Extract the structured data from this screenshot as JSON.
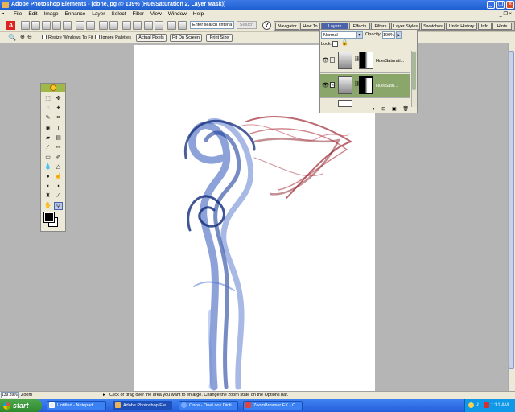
{
  "window": {
    "title": "Adobe Photoshop Elements - [done.jpg @ 139% (Hue/Saturation 2, Layer Mask)]",
    "controls": [
      "_",
      "❐",
      "×"
    ]
  },
  "menu": [
    "File",
    "Edit",
    "Image",
    "Enhance",
    "Layer",
    "Select",
    "Filter",
    "View",
    "Window",
    "Help"
  ],
  "shortcuts": {
    "search_placeholder": "Enter search criteria",
    "search_button": "Search",
    "help_icon": "?"
  },
  "palette_tabs": [
    "Navigator",
    "How To",
    "Layers",
    "Effects",
    "Filters",
    "Layer Styles",
    "Swatches",
    "Undo History",
    "Info",
    "Hints"
  ],
  "options": {
    "resize_windows": "Resize Windows To Fit",
    "ignore_palettes": "Ignore Palettes",
    "actual_pixels": "Actual Pixels",
    "fit_on_screen": "Fit On Screen",
    "print_size": "Print Size"
  },
  "layers_palette": {
    "blend_mode": "Normal",
    "opacity_label": "Opacity:",
    "opacity_value": "100%",
    "lock_label": "Lock:",
    "layers": [
      {
        "name": "Hue/Saturati..."
      },
      {
        "name": "Hue/Satu..."
      }
    ]
  },
  "status": {
    "zoom": "139.39%",
    "zoom_label": "Zoom",
    "hint": "Click or drag over the area you want to enlarge. Change the zoom state on the Options bar."
  },
  "taskbar": {
    "start": "start",
    "tasks": [
      {
        "label": "Untitled - Notepad",
        "active": false
      },
      {
        "label": "Adobe Photoshop Ele...",
        "active": true
      },
      {
        "label": "Once - OneLook Dicti...",
        "active": false
      },
      {
        "label": "ZoomBrowser EX - C...",
        "active": false
      }
    ],
    "clock": "1:31 AM"
  },
  "colors": {
    "smoke_blue": "#2f56b8",
    "smoke_red": "#a02a35",
    "selected_layer": "#8aa66a"
  }
}
